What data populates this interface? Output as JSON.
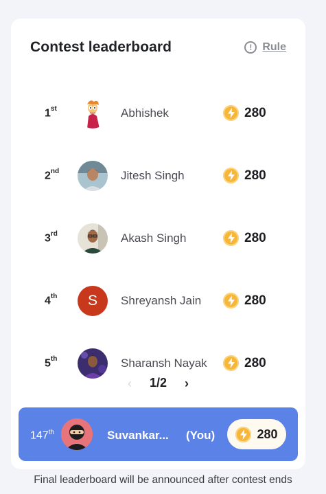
{
  "header": {
    "title": "Contest leaderboard",
    "rule_label": "Rule",
    "info_glyph": "!"
  },
  "leaders": [
    {
      "rank_num": "1",
      "rank_suffix": "st",
      "name": "Abhishek",
      "points": "280"
    },
    {
      "rank_num": "2",
      "rank_suffix": "nd",
      "name": "Jitesh Singh",
      "points": "280"
    },
    {
      "rank_num": "3",
      "rank_suffix": "rd",
      "name": "Akash Singh",
      "points": "280"
    },
    {
      "rank_num": "4",
      "rank_suffix": "th",
      "name": "Shreyansh Jain",
      "points": "280",
      "initial": "S"
    },
    {
      "rank_num": "5",
      "rank_suffix": "th",
      "name": "Sharansh Nayak",
      "points": "280"
    }
  ],
  "pagination": {
    "prev_glyph": "‹",
    "next_glyph": "›",
    "text": "1/2"
  },
  "current_user": {
    "rank_num": "147",
    "rank_suffix": "th",
    "name": "Suvankar...",
    "you_label": "(You)",
    "points": "280"
  },
  "footer": {
    "note": "Final leaderboard will be announced after contest ends"
  },
  "colors": {
    "accent_blue": "#5b82e6",
    "coin_gold": "#f6b63a",
    "avatar_initial_bg": "#c8381c"
  },
  "icons": [
    "info-icon",
    "lightning-coin-icon",
    "chevron-left-icon",
    "chevron-right-icon"
  ]
}
